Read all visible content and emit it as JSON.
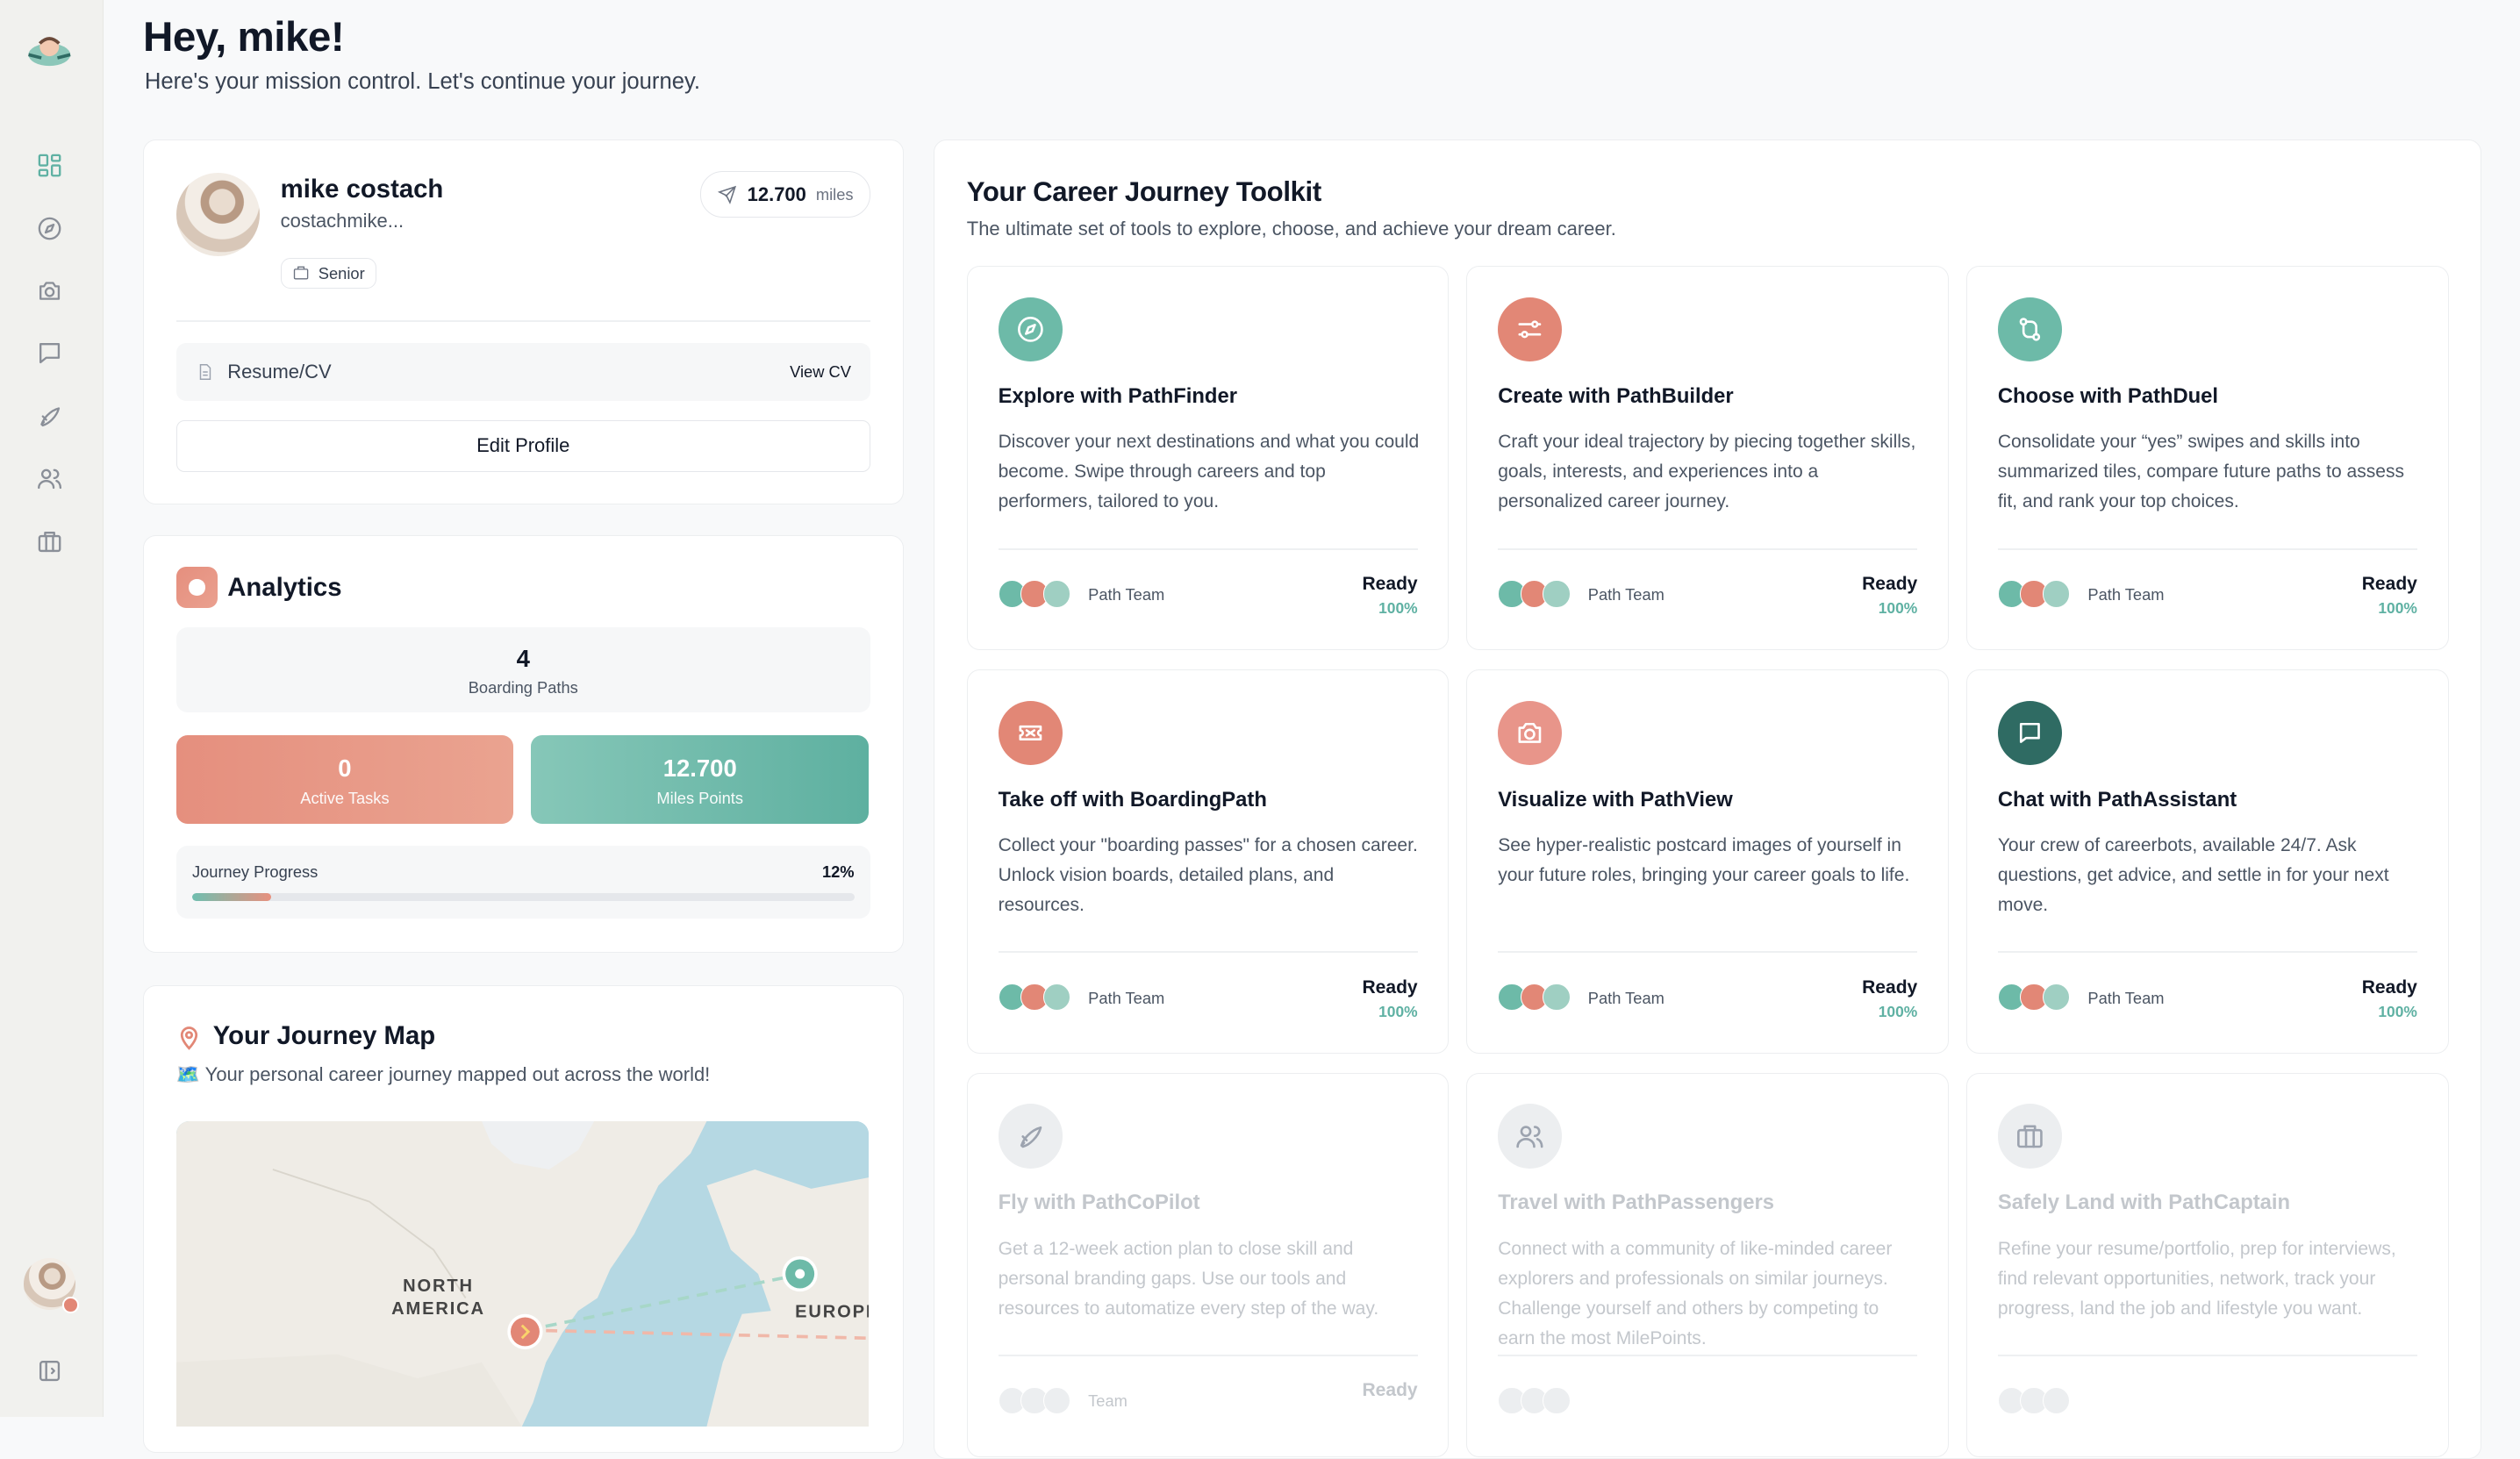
{
  "greeting": {
    "title": "Hey, mike!",
    "subtitle": "Here's your mission control. Let's continue your journey."
  },
  "sidebar": {
    "items": [
      {
        "icon": "dashboard-icon",
        "active": true
      },
      {
        "icon": "compass-icon"
      },
      {
        "icon": "camera-icon"
      },
      {
        "icon": "chat-icon"
      },
      {
        "icon": "rocket-icon"
      },
      {
        "icon": "users-icon"
      },
      {
        "icon": "briefcase-icon"
      }
    ],
    "collapse_icon": "sidebar-toggle-icon"
  },
  "profile": {
    "name": "mike costach",
    "handle": "costachmike...",
    "badge": "Senior",
    "miles_value": "12.700",
    "miles_unit": "miles",
    "resume_label": "Resume/CV",
    "resume_action": "View CV",
    "edit_label": "Edit Profile"
  },
  "analytics": {
    "title": "Analytics",
    "boarding_value": "4",
    "boarding_label": "Boarding Paths",
    "active_tasks_value": "0",
    "active_tasks_label": "Active Tasks",
    "miles_points_value": "12.700",
    "miles_points_label": "Miles Points",
    "progress_label": "Journey Progress",
    "progress_text": "12%",
    "progress_fraction": 0.12
  },
  "map": {
    "title": "Your Journey Map",
    "subtitle": "🗺️ Your personal career journey mapped out across the world!",
    "labels": {
      "north_america_1": "NORTH",
      "north_america_2": "AMERICA",
      "europe": "EUROPE"
    }
  },
  "toolkit": {
    "title": "Your Career Journey Toolkit",
    "subtitle": "The ultimate set of tools to explore, choose, and achieve your dream career.",
    "tools": [
      {
        "title": "Explore with PathFinder",
        "desc": "Discover your next destinations and what you could become. Swipe through careers and top performers, tailored to you.",
        "team": "Path Team",
        "status": "Ready",
        "percent": "100%",
        "icon": "compass-icon",
        "color": "#6dbaa8",
        "dim": false
      },
      {
        "title": "Create with PathBuilder",
        "desc": "Craft your ideal trajectory by piecing together skills, goals, interests, and experiences into a personalized career journey.",
        "team": "Path Team",
        "status": "Ready",
        "percent": "100%",
        "icon": "sliders-icon",
        "color": "#e28776",
        "dim": false
      },
      {
        "title": "Choose with PathDuel",
        "desc": "Consolidate your “yes” swipes and skills into summarized tiles, compare future paths to assess fit, and rank your top choices.",
        "team": "Path Team",
        "status": "Ready",
        "percent": "100%",
        "icon": "compare-icon",
        "color": "#6dbaa8",
        "dim": false
      },
      {
        "title": "Take off with BoardingPath",
        "desc": "Collect your \"boarding passes\" for a chosen career. Unlock vision boards, detailed plans, and resources.",
        "team": "Path Team",
        "status": "Ready",
        "percent": "100%",
        "icon": "ticket-icon",
        "color": "#e28776",
        "dim": false
      },
      {
        "title": "Visualize with PathView",
        "desc": "See hyper-realistic postcard images of yourself in your future roles, bringing your career goals to life.",
        "team": "Path Team",
        "status": "Ready",
        "percent": "100%",
        "icon": "camera-icon",
        "color": "#e8958a",
        "dim": false
      },
      {
        "title": "Chat with PathAssistant",
        "desc": "Your crew of careerbots, available 24/7. Ask questions, get advice, and settle in for your next move.",
        "team": "Path Team",
        "status": "Ready",
        "percent": "100%",
        "icon": "chat-icon",
        "color": "#2f6b63",
        "dim": false
      },
      {
        "title": "Fly with PathCoPilot",
        "desc": "Get a 12-week action plan to close skill and personal branding gaps. Use our tools and resources to automatize every step of the way.",
        "team": "Team",
        "status": "Ready",
        "percent": "",
        "icon": "rocket-icon",
        "color": "#eceef0",
        "dim": true
      },
      {
        "title": "Travel with PathPassengers",
        "desc": "Connect with a community of like-minded career explorers and professionals on similar journeys. Challenge yourself and others by competing to earn the most MilePoints.",
        "team": "",
        "status": "",
        "percent": "",
        "icon": "users-icon",
        "color": "#eceef0",
        "dim": true
      },
      {
        "title": "Safely Land with PathCaptain",
        "desc": "Refine your resume/portfolio, prep for interviews, find relevant opportunities, network, track your progress, land the job and lifestyle you want.",
        "team": "",
        "status": "",
        "percent": "",
        "icon": "briefcase-icon",
        "color": "#eceef0",
        "dim": true
      }
    ]
  },
  "colors": {
    "teal": "#6dbaa8",
    "coral": "#e28776",
    "dark_teal": "#2f6b63"
  }
}
